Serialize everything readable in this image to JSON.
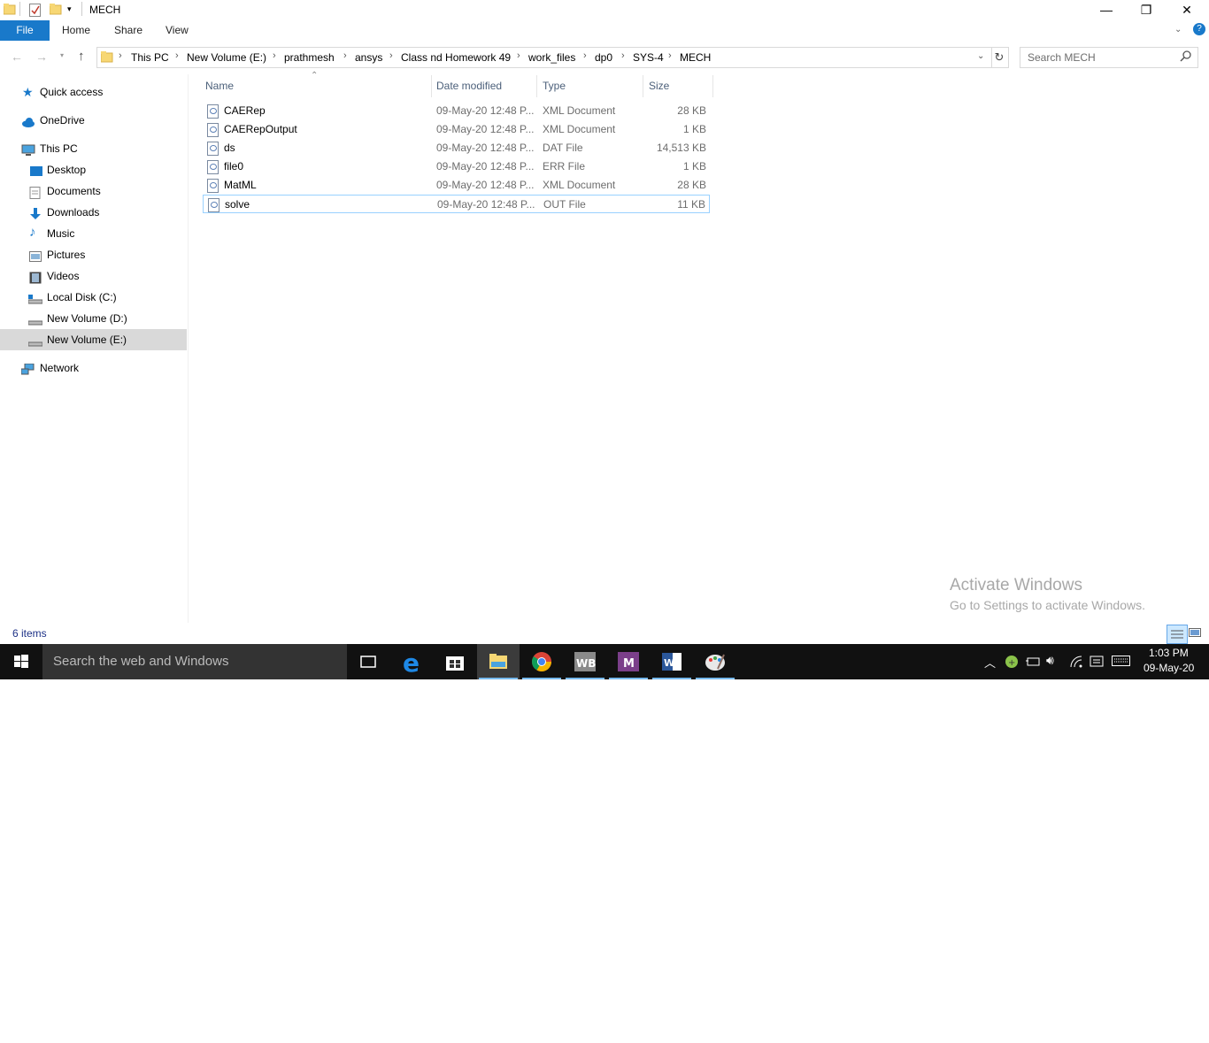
{
  "window": {
    "title": "MECH",
    "controls": {
      "minimize": "—",
      "restore": "❐",
      "close": "✕"
    }
  },
  "ribbon": {
    "tabs": [
      "File",
      "Home",
      "Share",
      "View"
    ]
  },
  "address": {
    "breadcrumbs": [
      "This PC",
      "New Volume (E:)",
      "prathmesh",
      "ansys",
      "Class nd Homework 49",
      "work_files",
      "dp0",
      "SYS-4",
      "MECH"
    ],
    "search_placeholder": "Search MECH"
  },
  "nav": {
    "items": [
      {
        "label": "Quick access",
        "icon": "star-icon"
      },
      {
        "label": "OneDrive",
        "icon": "cloud-icon"
      },
      {
        "label": "This PC",
        "icon": "computer-icon"
      },
      {
        "label": "Desktop",
        "icon": "desktop-icon"
      },
      {
        "label": "Documents",
        "icon": "documents-icon"
      },
      {
        "label": "Downloads",
        "icon": "download-arrow-icon"
      },
      {
        "label": "Music",
        "icon": "music-note-icon"
      },
      {
        "label": "Pictures",
        "icon": "pictures-icon"
      },
      {
        "label": "Videos",
        "icon": "film-icon"
      },
      {
        "label": "Local Disk (C:)",
        "icon": "drive-icon"
      },
      {
        "label": "New Volume (D:)",
        "icon": "drive-icon"
      },
      {
        "label": "New Volume (E:)",
        "icon": "drive-icon"
      },
      {
        "label": "Network",
        "icon": "network-icon"
      }
    ],
    "selected": "New Volume (E:)"
  },
  "columns": [
    "Name",
    "Date modified",
    "Type",
    "Size"
  ],
  "files": [
    {
      "name": "CAERep",
      "date": "09-May-20 12:48 P...",
      "type": "XML Document",
      "size": "28 KB"
    },
    {
      "name": "CAERepOutput",
      "date": "09-May-20 12:48 P...",
      "type": "XML Document",
      "size": "1 KB"
    },
    {
      "name": "ds",
      "date": "09-May-20 12:48 P...",
      "type": "DAT File",
      "size": "14,513 KB"
    },
    {
      "name": "file0",
      "date": "09-May-20 12:48 P...",
      "type": "ERR File",
      "size": "1 KB"
    },
    {
      "name": "MatML",
      "date": "09-May-20 12:48 P...",
      "type": "XML Document",
      "size": "28 KB"
    },
    {
      "name": "solve",
      "date": "09-May-20 12:48 P...",
      "type": "OUT File",
      "size": "11 KB"
    }
  ],
  "watermark": {
    "title": "Activate Windows",
    "subtitle": "Go to Settings to activate Windows."
  },
  "status": {
    "item_count": "6 items"
  },
  "taskbar": {
    "search_placeholder": "Search the web and Windows",
    "apps": [
      "task-view-icon",
      "edge-icon",
      "store-icon",
      "file-explorer-icon",
      "chrome-icon",
      "workbench-icon",
      "onenote-icon",
      "word-icon",
      "paint-icon"
    ],
    "clock_time": "1:03 PM",
    "clock_date": "09-May-20",
    "colors": {
      "accent": "#1979ca",
      "taskbar": "#111111",
      "active_line": "#76b9ed"
    }
  }
}
